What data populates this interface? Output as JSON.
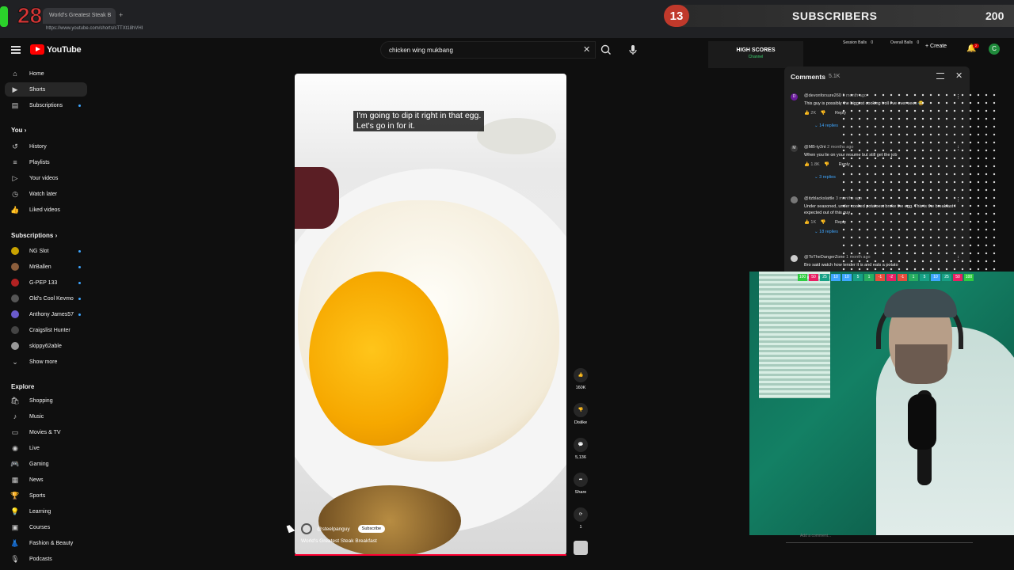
{
  "browser": {
    "tab_title": "World's Greatest Steak B",
    "url": "https://www.youtube.com/shorts/sTTXt18hVHI"
  },
  "overlay": {
    "counter": "28",
    "subscriber_count": "13",
    "subscriber_label": "SUBSCRIBERS",
    "subscriber_goal": "200",
    "high_scores_title": "HIGH SCORES",
    "high_scores_sub": "Channel",
    "session_balls": "Session Balls",
    "session_balls_value": "0",
    "overall_balls": "Overall Balls",
    "overall_balls_value": "0",
    "scoreboard": [
      {
        "label": "100",
        "color": "#2ecc40"
      },
      {
        "label": "50",
        "color": "#e91e63"
      },
      {
        "label": "25",
        "color": "#16a085"
      },
      {
        "label": "10",
        "color": "#3ea6ff"
      },
      {
        "label": "10",
        "color": "#3ea6ff"
      },
      {
        "label": "5",
        "color": "#16a085"
      },
      {
        "label": "1",
        "color": "#27ae60"
      },
      {
        "label": "-1",
        "color": "#e74c3c"
      },
      {
        "label": "-2",
        "color": "#e91e63"
      },
      {
        "label": "-1",
        "color": "#e74c3c"
      },
      {
        "label": "1",
        "color": "#27ae60"
      },
      {
        "label": "5",
        "color": "#16a085"
      },
      {
        "label": "10",
        "color": "#3ea6ff"
      },
      {
        "label": "25",
        "color": "#16a085"
      },
      {
        "label": "50",
        "color": "#e91e63"
      },
      {
        "label": "100",
        "color": "#2ecc40"
      }
    ]
  },
  "header": {
    "logo_text": "YouTube",
    "search_value": "chicken wing mukbang",
    "create_label": "Create",
    "avatar_letter": "C",
    "notification_count": "2"
  },
  "sidebar": {
    "main": [
      {
        "label": "Home",
        "icon": "home-icon"
      },
      {
        "label": "Shorts",
        "icon": "shorts-icon"
      },
      {
        "label": "Subscriptions",
        "icon": "subscriptions-icon"
      }
    ],
    "you_heading": "You",
    "you": [
      {
        "label": "History",
        "icon": "history-icon"
      },
      {
        "label": "Playlists",
        "icon": "playlists-icon"
      },
      {
        "label": "Your videos",
        "icon": "your-videos-icon"
      },
      {
        "label": "Watch later",
        "icon": "watch-later-icon"
      },
      {
        "label": "Liked videos",
        "icon": "liked-videos-icon"
      }
    ],
    "subscriptions_heading": "Subscriptions",
    "subscriptions": [
      {
        "label": "NG Slot",
        "color": "#c8a200"
      },
      {
        "label": "MrBallen",
        "color": "#8b5e3c"
      },
      {
        "label": "G-PEP 133",
        "color": "#b22222"
      },
      {
        "label": "Old's Cool Kevmo",
        "color": "#555555"
      },
      {
        "label": "Anthony James57",
        "color": "#6a5acd"
      },
      {
        "label": "Craigslist Hunter",
        "color": "#444444"
      },
      {
        "label": "skippy62able",
        "color": "#999999"
      }
    ],
    "show_more": "Show more",
    "explore_heading": "Explore",
    "explore": [
      {
        "label": "Shopping",
        "icon": "shopping-icon"
      },
      {
        "label": "Music",
        "icon": "music-icon"
      },
      {
        "label": "Movies & TV",
        "icon": "movies-icon"
      },
      {
        "label": "Live",
        "icon": "live-icon"
      },
      {
        "label": "Gaming",
        "icon": "gaming-icon"
      },
      {
        "label": "News",
        "icon": "news-icon"
      },
      {
        "label": "Sports",
        "icon": "sports-icon"
      },
      {
        "label": "Learning",
        "icon": "learning-icon"
      },
      {
        "label": "Courses",
        "icon": "courses-icon"
      },
      {
        "label": "Fashion & Beauty",
        "icon": "fashion-icon"
      },
      {
        "label": "Podcasts",
        "icon": "podcasts-icon"
      }
    ]
  },
  "short": {
    "caption": "I'm going to dip it right in that egg.\nLet's go in for it.",
    "channel": "@steelpanguy",
    "subscribe_label": "Subscribe",
    "title": "World's Greatest Steak Breakfast",
    "progress": 1.0
  },
  "actions": {
    "likes": "160K",
    "dislike_label": "Dislike",
    "comments": "5,136",
    "share_label": "Share",
    "remix_count": "1"
  },
  "comments": {
    "title": "Comments",
    "count": "5.1K",
    "items": [
      {
        "user": "@devonforsure260",
        "time": "1 month ago",
        "text": "This guy is possibly the biggest cooking troll I've ever seen 😂",
        "likes": "2K",
        "reply": "Reply",
        "replies": "14 replies",
        "avatar_color": "#6a1b9a",
        "avatar_letter": "D"
      },
      {
        "user": "@MB-ty2nt",
        "time": "2 months ago",
        "text": "When you lie on your resume but still get the job",
        "likes": "1.8K",
        "reply": "Reply",
        "replies": "3 replies",
        "avatar_color": "#3a3a3a",
        "avatar_letter": "M"
      },
      {
        "user": "@itzblackslattle",
        "time": "3 months ago",
        "text": "Under seasoned, under cooked potatoes, broke the egg. This is the breakfast I expected out of this guy",
        "likes": "1K",
        "reply": "Reply",
        "replies": "18 replies",
        "avatar_color": "#777777",
        "avatar_letter": ""
      },
      {
        "user": "@ToTheDangerZone",
        "time": "1 month ago",
        "text": "Bro said watch how tender it is and eats a potato",
        "likes": "",
        "reply": "",
        "replies": "",
        "avatar_color": "#cccccc",
        "avatar_letter": ""
      }
    ],
    "input_placeholder": "Add a comment..."
  }
}
